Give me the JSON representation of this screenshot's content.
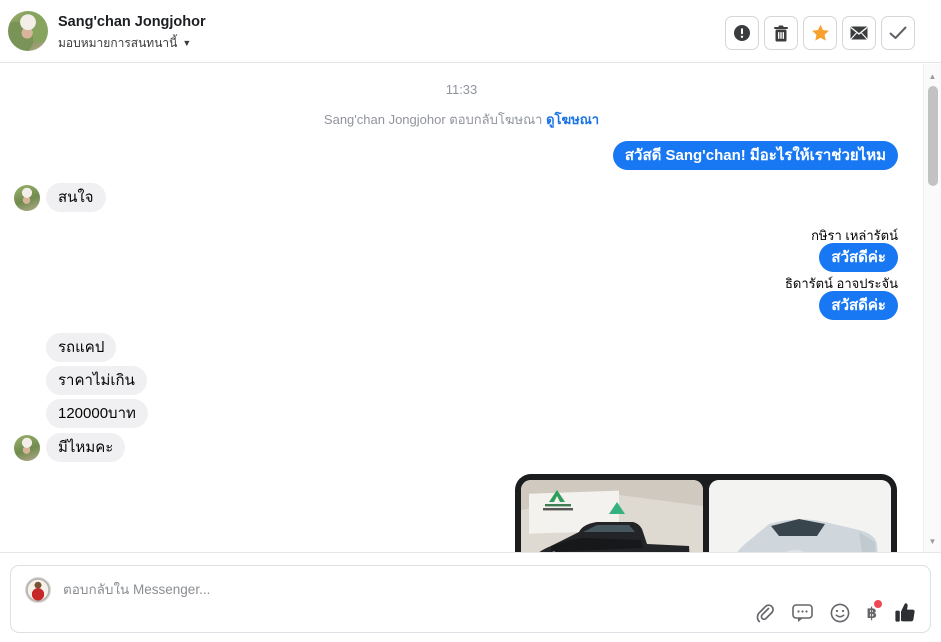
{
  "colors": {
    "accent_blue": "#1877f2",
    "bubble_gray": "#f0f0f2",
    "star_orange": "#f7a22d",
    "badge_red": "#ed4956",
    "link_blue": "#1b74e4"
  },
  "header": {
    "name": "Sang'chan Jongjohor",
    "assign_label": "มอบหมายการสนทนานี้",
    "actions": [
      {
        "icon": "exclamation-circle-icon"
      },
      {
        "icon": "trash-icon"
      },
      {
        "icon": "star-icon"
      },
      {
        "icon": "envelope-icon"
      },
      {
        "icon": "check-icon"
      }
    ]
  },
  "chat": {
    "timestamp": "11:33",
    "ad_context": {
      "text": "Sang'chan Jongjohor ตอบกลับโฆษณา",
      "link_label": "ดูโฆษณา"
    },
    "messages": [
      {
        "side": "outgoing",
        "type": "bubble",
        "text": "สวัสดี Sang'chan! มีอะไรให้เราช่วยไหม"
      },
      {
        "side": "incoming",
        "type": "bubble",
        "text": "สนใจ",
        "show_avatar": true
      },
      {
        "side": "outgoing",
        "type": "sender_name",
        "text": "กษิรา เหล่ารัตน์"
      },
      {
        "side": "outgoing",
        "type": "bubble",
        "text": "สวัสดีค่ะ"
      },
      {
        "side": "outgoing",
        "type": "sender_name",
        "text": "ธิดารัตน์ อาจประจัน"
      },
      {
        "side": "outgoing",
        "type": "bubble",
        "text": "สวัสดีค่ะ"
      },
      {
        "side": "incoming",
        "type": "bubble",
        "text": "รถแคป"
      },
      {
        "side": "incoming",
        "type": "bubble",
        "text": "ราคาไม่เกิน"
      },
      {
        "side": "incoming",
        "type": "bubble",
        "text": "120000บาท"
      },
      {
        "side": "incoming",
        "type": "bubble",
        "text": "มีไหมคะ",
        "show_avatar": true
      }
    ],
    "attachment": {
      "type": "image-carousel",
      "images": [
        {
          "label": "black pickup truck at auction tent"
        },
        {
          "label": "silver pickup truck studio photo"
        }
      ]
    }
  },
  "composer": {
    "placeholder": "ตอบกลับใน Messenger...",
    "icons": [
      "paperclip-icon",
      "saved-replies-icon",
      "emoji-icon",
      "payment-baht-icon",
      "like-thumb-icon"
    ]
  }
}
